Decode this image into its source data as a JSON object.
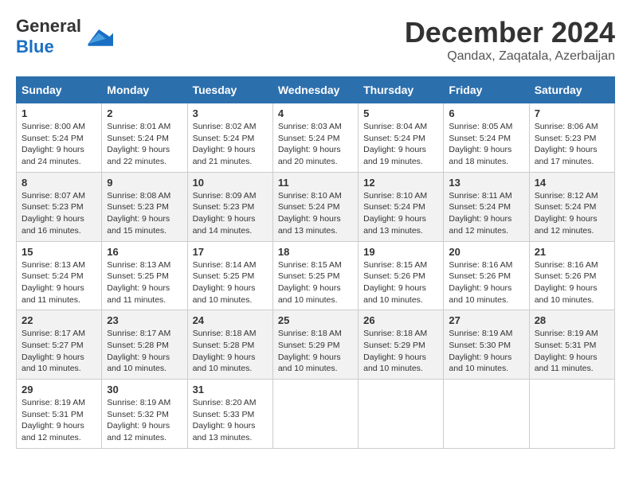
{
  "header": {
    "logo_general": "General",
    "logo_blue": "Blue",
    "month_year": "December 2024",
    "location": "Qandax, Zaqatala, Azerbaijan"
  },
  "weekdays": [
    "Sunday",
    "Monday",
    "Tuesday",
    "Wednesday",
    "Thursday",
    "Friday",
    "Saturday"
  ],
  "weeks": [
    [
      {
        "day": "1",
        "sunrise": "Sunrise: 8:00 AM",
        "sunset": "Sunset: 5:24 PM",
        "daylight": "Daylight: 9 hours and 24 minutes."
      },
      {
        "day": "2",
        "sunrise": "Sunrise: 8:01 AM",
        "sunset": "Sunset: 5:24 PM",
        "daylight": "Daylight: 9 hours and 22 minutes."
      },
      {
        "day": "3",
        "sunrise": "Sunrise: 8:02 AM",
        "sunset": "Sunset: 5:24 PM",
        "daylight": "Daylight: 9 hours and 21 minutes."
      },
      {
        "day": "4",
        "sunrise": "Sunrise: 8:03 AM",
        "sunset": "Sunset: 5:24 PM",
        "daylight": "Daylight: 9 hours and 20 minutes."
      },
      {
        "day": "5",
        "sunrise": "Sunrise: 8:04 AM",
        "sunset": "Sunset: 5:24 PM",
        "daylight": "Daylight: 9 hours and 19 minutes."
      },
      {
        "day": "6",
        "sunrise": "Sunrise: 8:05 AM",
        "sunset": "Sunset: 5:24 PM",
        "daylight": "Daylight: 9 hours and 18 minutes."
      },
      {
        "day": "7",
        "sunrise": "Sunrise: 8:06 AM",
        "sunset": "Sunset: 5:23 PM",
        "daylight": "Daylight: 9 hours and 17 minutes."
      }
    ],
    [
      {
        "day": "8",
        "sunrise": "Sunrise: 8:07 AM",
        "sunset": "Sunset: 5:23 PM",
        "daylight": "Daylight: 9 hours and 16 minutes."
      },
      {
        "day": "9",
        "sunrise": "Sunrise: 8:08 AM",
        "sunset": "Sunset: 5:23 PM",
        "daylight": "Daylight: 9 hours and 15 minutes."
      },
      {
        "day": "10",
        "sunrise": "Sunrise: 8:09 AM",
        "sunset": "Sunset: 5:23 PM",
        "daylight": "Daylight: 9 hours and 14 minutes."
      },
      {
        "day": "11",
        "sunrise": "Sunrise: 8:10 AM",
        "sunset": "Sunset: 5:24 PM",
        "daylight": "Daylight: 9 hours and 13 minutes."
      },
      {
        "day": "12",
        "sunrise": "Sunrise: 8:10 AM",
        "sunset": "Sunset: 5:24 PM",
        "daylight": "Daylight: 9 hours and 13 minutes."
      },
      {
        "day": "13",
        "sunrise": "Sunrise: 8:11 AM",
        "sunset": "Sunset: 5:24 PM",
        "daylight": "Daylight: 9 hours and 12 minutes."
      },
      {
        "day": "14",
        "sunrise": "Sunrise: 8:12 AM",
        "sunset": "Sunset: 5:24 PM",
        "daylight": "Daylight: 9 hours and 12 minutes."
      }
    ],
    [
      {
        "day": "15",
        "sunrise": "Sunrise: 8:13 AM",
        "sunset": "Sunset: 5:24 PM",
        "daylight": "Daylight: 9 hours and 11 minutes."
      },
      {
        "day": "16",
        "sunrise": "Sunrise: 8:13 AM",
        "sunset": "Sunset: 5:25 PM",
        "daylight": "Daylight: 9 hours and 11 minutes."
      },
      {
        "day": "17",
        "sunrise": "Sunrise: 8:14 AM",
        "sunset": "Sunset: 5:25 PM",
        "daylight": "Daylight: 9 hours and 10 minutes."
      },
      {
        "day": "18",
        "sunrise": "Sunrise: 8:15 AM",
        "sunset": "Sunset: 5:25 PM",
        "daylight": "Daylight: 9 hours and 10 minutes."
      },
      {
        "day": "19",
        "sunrise": "Sunrise: 8:15 AM",
        "sunset": "Sunset: 5:26 PM",
        "daylight": "Daylight: 9 hours and 10 minutes."
      },
      {
        "day": "20",
        "sunrise": "Sunrise: 8:16 AM",
        "sunset": "Sunset: 5:26 PM",
        "daylight": "Daylight: 9 hours and 10 minutes."
      },
      {
        "day": "21",
        "sunrise": "Sunrise: 8:16 AM",
        "sunset": "Sunset: 5:26 PM",
        "daylight": "Daylight: 9 hours and 10 minutes."
      }
    ],
    [
      {
        "day": "22",
        "sunrise": "Sunrise: 8:17 AM",
        "sunset": "Sunset: 5:27 PM",
        "daylight": "Daylight: 9 hours and 10 minutes."
      },
      {
        "day": "23",
        "sunrise": "Sunrise: 8:17 AM",
        "sunset": "Sunset: 5:28 PM",
        "daylight": "Daylight: 9 hours and 10 minutes."
      },
      {
        "day": "24",
        "sunrise": "Sunrise: 8:18 AM",
        "sunset": "Sunset: 5:28 PM",
        "daylight": "Daylight: 9 hours and 10 minutes."
      },
      {
        "day": "25",
        "sunrise": "Sunrise: 8:18 AM",
        "sunset": "Sunset: 5:29 PM",
        "daylight": "Daylight: 9 hours and 10 minutes."
      },
      {
        "day": "26",
        "sunrise": "Sunrise: 8:18 AM",
        "sunset": "Sunset: 5:29 PM",
        "daylight": "Daylight: 9 hours and 10 minutes."
      },
      {
        "day": "27",
        "sunrise": "Sunrise: 8:19 AM",
        "sunset": "Sunset: 5:30 PM",
        "daylight": "Daylight: 9 hours and 10 minutes."
      },
      {
        "day": "28",
        "sunrise": "Sunrise: 8:19 AM",
        "sunset": "Sunset: 5:31 PM",
        "daylight": "Daylight: 9 hours and 11 minutes."
      }
    ],
    [
      {
        "day": "29",
        "sunrise": "Sunrise: 8:19 AM",
        "sunset": "Sunset: 5:31 PM",
        "daylight": "Daylight: 9 hours and 12 minutes."
      },
      {
        "day": "30",
        "sunrise": "Sunrise: 8:19 AM",
        "sunset": "Sunset: 5:32 PM",
        "daylight": "Daylight: 9 hours and 12 minutes."
      },
      {
        "day": "31",
        "sunrise": "Sunrise: 8:20 AM",
        "sunset": "Sunset: 5:33 PM",
        "daylight": "Daylight: 9 hours and 13 minutes."
      },
      {
        "day": "",
        "sunrise": "",
        "sunset": "",
        "daylight": ""
      },
      {
        "day": "",
        "sunrise": "",
        "sunset": "",
        "daylight": ""
      },
      {
        "day": "",
        "sunrise": "",
        "sunset": "",
        "daylight": ""
      },
      {
        "day": "",
        "sunrise": "",
        "sunset": "",
        "daylight": ""
      }
    ]
  ]
}
